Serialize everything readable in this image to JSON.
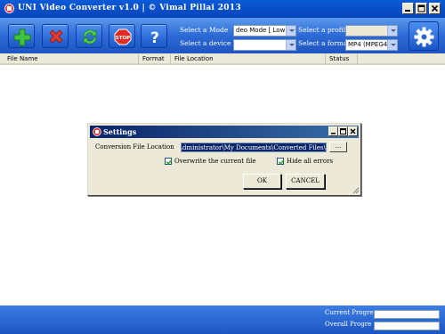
{
  "window": {
    "title": "UNI Video Converter v1.0 | © Vimal Pillai 2013"
  },
  "toolbar": {
    "mode_label": "Select a Mode",
    "mode_value": "deo Mode [ Low",
    "device_label": "Select a device",
    "device_value": "",
    "profile_label": "Select a profil",
    "profile_value": "",
    "format_label": "Select a format",
    "format_value": "MP4 (MPEG4)"
  },
  "list": {
    "columns": [
      "File Name",
      "Format",
      "File Location",
      "Status"
    ]
  },
  "status": {
    "current_label": "Current Progre",
    "overall_label": "Overall Progre",
    "current_progress": 0,
    "overall_progress": 0
  },
  "dialog": {
    "title": "Settings",
    "path_label": "Conversion File Location",
    "path_value": ".\\Administrator\\My Documents\\Converted Files\\",
    "browse_label": "...",
    "overwrite_label": "Overwrite the current file",
    "overwrite_checked": true,
    "hide_errors_label": "Hide all errors",
    "hide_errors_checked": true,
    "ok_label": "OK",
    "cancel_label": "CANCEL"
  },
  "colors": {
    "titlebar": "#0a5bd8",
    "toolbar": "#2c6ad6",
    "dialog_title": "#0a246a"
  },
  "icons": [
    "app-icon",
    "add-icon",
    "remove-icon",
    "refresh-icon",
    "stop-icon",
    "help-icon",
    "gear-icon"
  ]
}
